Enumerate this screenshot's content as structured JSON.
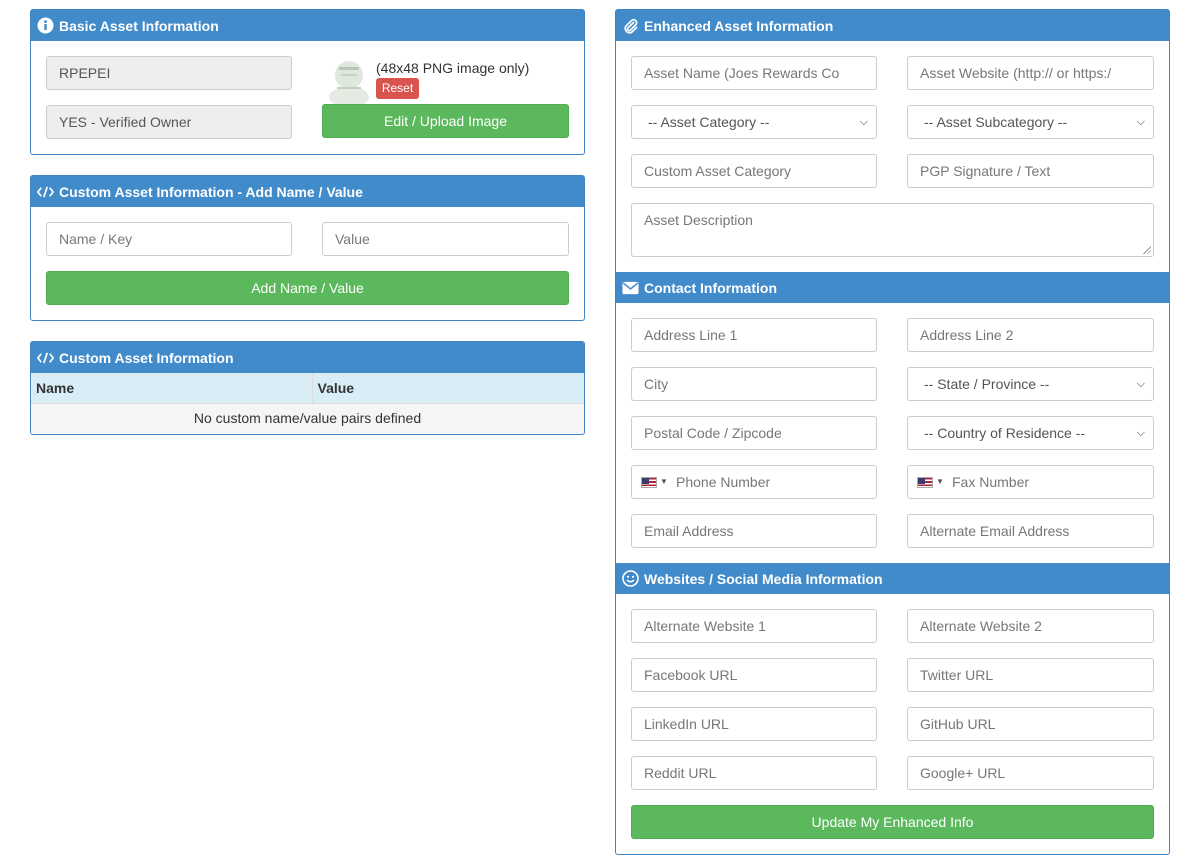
{
  "basic": {
    "title": "Basic Asset Information",
    "asset_code": "RPEPEI",
    "verified": "YES - Verified Owner",
    "image_note": "(48x48 PNG image only)",
    "reset_label": "Reset",
    "upload_label": "Edit / Upload Image"
  },
  "custom_add": {
    "title": "Custom Asset Information - Add Name / Value",
    "name_placeholder": "Name / Key",
    "value_placeholder": "Value",
    "add_label": "Add Name / Value"
  },
  "custom_list": {
    "title": "Custom Asset Information",
    "columns": [
      "Name",
      "Value"
    ],
    "empty_message": "No custom name/value pairs defined"
  },
  "enhanced": {
    "title": "Enhanced Asset Information",
    "asset_name_placeholder": "Asset Name (Joes Rewards Co",
    "asset_website_placeholder": "Asset Website (http:// or https:/",
    "category_select": "-- Asset Category --",
    "subcategory_select": "-- Asset Subcategory --",
    "custom_category_placeholder": "Custom Asset Category",
    "pgp_placeholder": "PGP Signature / Text",
    "description_placeholder": "Asset Description"
  },
  "contact": {
    "title": "Contact Information",
    "address1": "Address Line 1",
    "address2": "Address Line 2",
    "city": "City",
    "state_select": "-- State / Province --",
    "postal": "Postal Code / Zipcode",
    "country_select": "-- Country of Residence --",
    "phone": "Phone Number",
    "fax": "Fax Number",
    "email": "Email Address",
    "alt_email": "Alternate Email Address"
  },
  "social": {
    "title": "Websites / Social Media Information",
    "alt_site1": "Alternate Website 1",
    "alt_site2": "Alternate Website 2",
    "facebook": "Facebook URL",
    "twitter": "Twitter URL",
    "linkedin": "LinkedIn URL",
    "github": "GitHub URL",
    "reddit": "Reddit URL",
    "googleplus": "Google+ URL",
    "update_label": "Update My Enhanced Info"
  }
}
